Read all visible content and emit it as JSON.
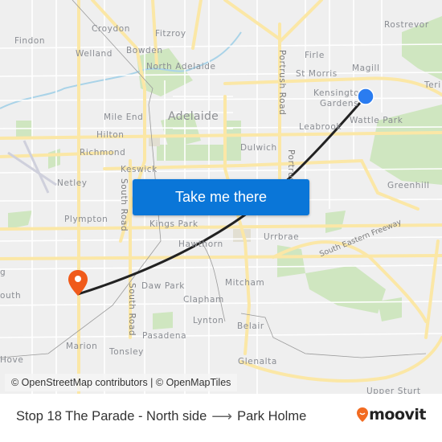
{
  "map": {
    "places": [
      {
        "id": "findon",
        "label": "Findon"
      },
      {
        "id": "croydon",
        "label": "Croydon"
      },
      {
        "id": "fitzroy",
        "label": "Fitzroy"
      },
      {
        "id": "welland",
        "label": "Welland"
      },
      {
        "id": "bowden",
        "label": "Bowden"
      },
      {
        "id": "north-adelaide",
        "label": "North Adelaide"
      },
      {
        "id": "rostrevor",
        "label": "Rostrevor"
      },
      {
        "id": "firle",
        "label": "Firle"
      },
      {
        "id": "magill",
        "label": "Magill"
      },
      {
        "id": "st-morris",
        "label": "St Morris"
      },
      {
        "id": "teringie",
        "label": "Teri"
      },
      {
        "id": "kensington-gardens-1",
        "label": "Kensingto"
      },
      {
        "id": "kensington-gardens-2",
        "label": "Gardens"
      },
      {
        "id": "mile-end",
        "label": "Mile End"
      },
      {
        "id": "adelaide",
        "label": "Adelaide"
      },
      {
        "id": "wattle-park",
        "label": "Wattle Park"
      },
      {
        "id": "leabrook",
        "label": "Leabrook"
      },
      {
        "id": "hilton",
        "label": "Hilton"
      },
      {
        "id": "richmond",
        "label": "Richmond"
      },
      {
        "id": "dulwich",
        "label": "Dulwich"
      },
      {
        "id": "keswick",
        "label": "Keswick"
      },
      {
        "id": "netley",
        "label": "Netley"
      },
      {
        "id": "greenhill",
        "label": "Greenhill"
      },
      {
        "id": "plympton",
        "label": "Plympton"
      },
      {
        "id": "kings-park",
        "label": "Kings Park"
      },
      {
        "id": "hawthorn",
        "label": "Hawthorn"
      },
      {
        "id": "urrbrae",
        "label": "Urrbrae"
      },
      {
        "id": "mitcham",
        "label": "Mitcham"
      },
      {
        "id": "daw-park",
        "label": "Daw Park"
      },
      {
        "id": "clapham",
        "label": "Clapham"
      },
      {
        "id": "lynton",
        "label": "Lynton"
      },
      {
        "id": "belair",
        "label": "Belair"
      },
      {
        "id": "pasadena",
        "label": "Pasadena"
      },
      {
        "id": "marion",
        "label": "Marion"
      },
      {
        "id": "tonsley",
        "label": "Tonsley"
      },
      {
        "id": "hove",
        "label": "Hove"
      },
      {
        "id": "glenalta",
        "label": "Glenalta"
      },
      {
        "id": "upper-sturt",
        "label": "Upper Sturt"
      },
      {
        "id": "south-left",
        "label": "outh"
      },
      {
        "id": "g-left",
        "label": "g"
      }
    ],
    "roads": {
      "portrush_1": "Portrush Road",
      "portrush_2": "Portrus",
      "south_road_1": "South Road",
      "south_road_2": "South Road",
      "south_eastern_freeway": "South Eastern Freeway"
    },
    "origin_marker": {
      "label": "Stop 18 The Parade - North side",
      "color": "#2a7cf0"
    },
    "destination_marker": {
      "label": "Park Holme",
      "color": "#f05a1a"
    },
    "route_line_color": "#222222",
    "cta_label": "Take me there",
    "attribution": "© OpenStreetMap contributors | © OpenMapTiles"
  },
  "footer": {
    "origin": "Stop 18 The Parade - North side",
    "arrow": "⟶",
    "destination": "Park Holme",
    "brand": "moovit",
    "brand_color": "#f26b21"
  }
}
